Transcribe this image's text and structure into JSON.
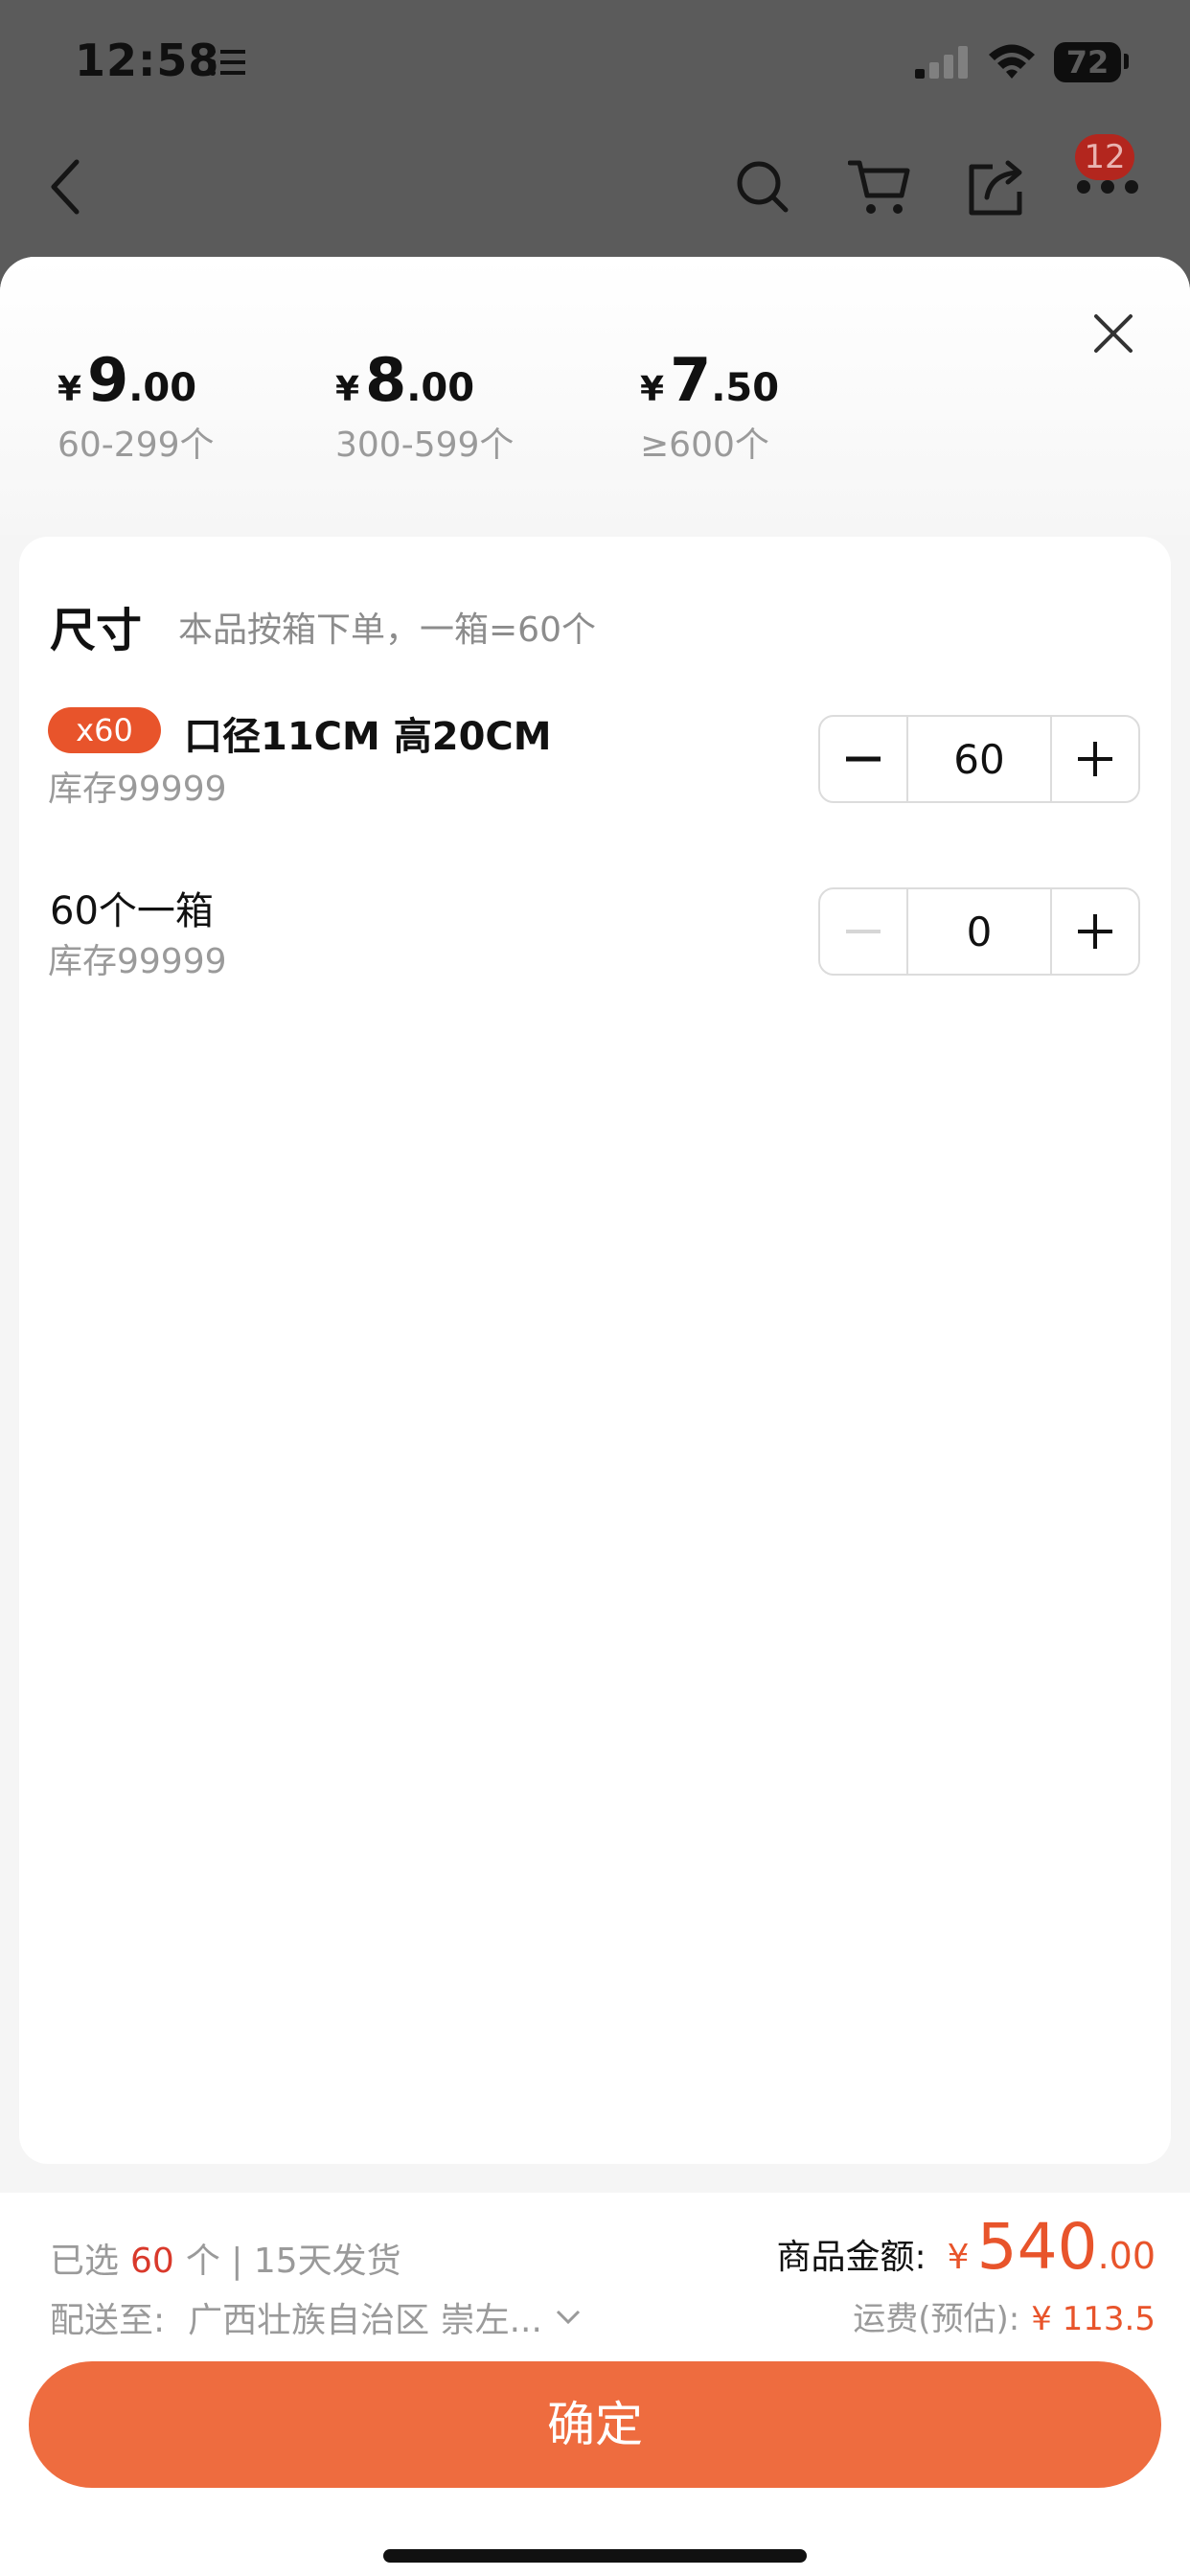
{
  "status": {
    "time": "12:58",
    "battery": "72"
  },
  "nav": {
    "cart_badge": "12"
  },
  "tiers": [
    {
      "yen": "¥",
      "int": "9",
      "dec": ".00",
      "range": "60-299个"
    },
    {
      "yen": "¥",
      "int": "8",
      "dec": ".00",
      "range": "300-599个"
    },
    {
      "yen": "¥",
      "int": "7",
      "dec": ".50",
      "range": "≥600个"
    }
  ],
  "size_section": {
    "title": "尺寸",
    "note": "本品按箱下单，一箱=60个"
  },
  "options": [
    {
      "badge": "x60",
      "name": "口径11CM 高20CM",
      "stock": "库存99999",
      "qty": "60"
    },
    {
      "badge": "",
      "name": "60个一箱",
      "stock": "库存99999",
      "qty": "0"
    }
  ],
  "footer": {
    "selected_prefix": "已选",
    "selected_count": "60",
    "selected_suffix": "个 | 15天发货",
    "ship_label": "配送至:",
    "ship_address": "广西壮族自治区 崇左...",
    "amount_label": "商品金额:",
    "amount_yen": "¥",
    "amount_int": "540",
    "amount_dec": ".00",
    "freight_label": "运费(预估):",
    "freight_value": "¥ 113.5",
    "confirm_label": "确定"
  },
  "colors": {
    "accent": "#e8542b",
    "confirm_bg": "#ee6c3f"
  }
}
